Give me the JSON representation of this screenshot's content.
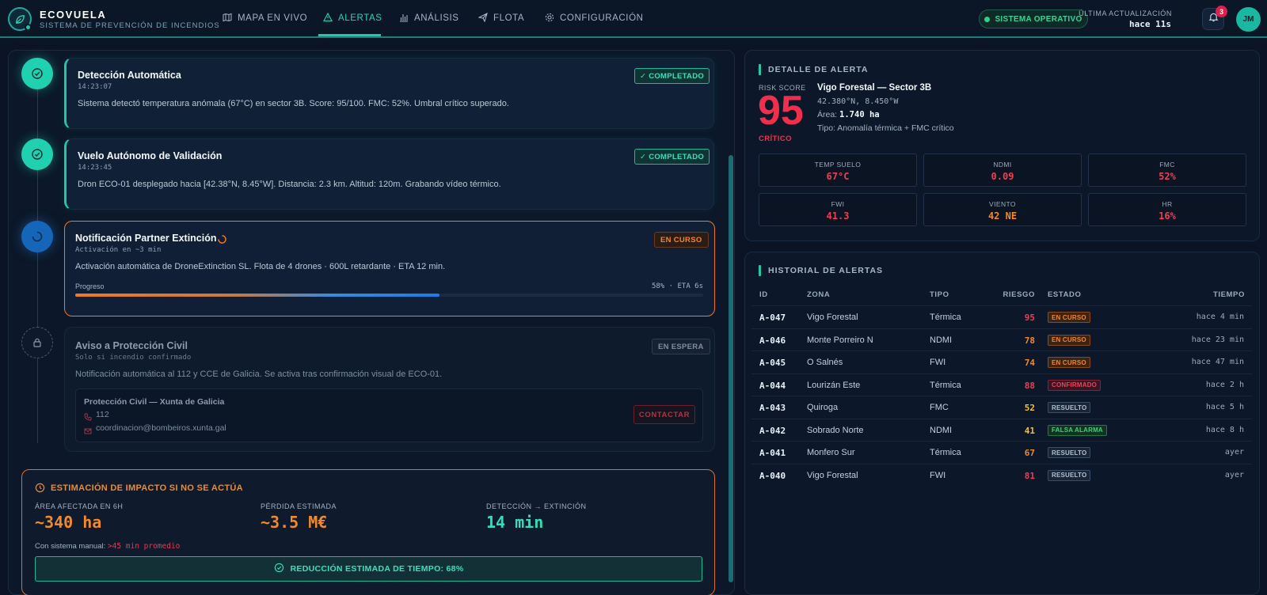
{
  "app": {
    "name": "ECOVUELA",
    "subtitle": "SISTEMA DE PREVENCIÓN DE INCENDIOS"
  },
  "nav": [
    {
      "label": "MAPA EN VIVO",
      "icon": "map-icon"
    },
    {
      "label": "ALERTAS",
      "icon": "alert-triangle-icon"
    },
    {
      "label": "ANÁLISIS",
      "icon": "bar-chart-icon"
    },
    {
      "label": "FLOTA",
      "icon": "plane-icon"
    },
    {
      "label": "CONFIGURACIÓN",
      "icon": "gear-icon"
    }
  ],
  "header": {
    "status": "SISTEMA OPERATIVO",
    "update_label": "ÚLTIMA ACTUALIZACIÓN",
    "update_value": "hace 11s",
    "notifications": "3",
    "user_initials": "JM"
  },
  "timeline": {
    "steps": [
      {
        "title": "Detección Automática",
        "time": "14:23:07",
        "description": "Sistema detectó temperatura anómala (67°C) en sector 3B. Score: 95/100. FMC: 52%. Umbral crítico superado.",
        "badge": "✓ COMPLETADO"
      },
      {
        "title": "Vuelo Autónomo de Validación",
        "time": "14:23:45",
        "description": "Dron ECO-01 desplegado hacia [42.38°N, 8.45°W]. Distancia: 2.3 km. Altitud: 120m. Grabando vídeo térmico.",
        "badge": "✓ COMPLETADO"
      },
      {
        "title": "Notificación Partner Extinción",
        "time": "Activación en ~3 min",
        "description": "Activación automática de DroneExtinction SL. Flota de 4 drones · 600L retardante · ETA 12 min.",
        "badge": "EN CURSO",
        "progress_label": "Progreso",
        "progress_text": "58% · ETA 6s",
        "progress": 0.58
      },
      {
        "title": "Aviso a Protección Civil",
        "time": "Solo si incendio confirmado",
        "description": "Notificación automática al 112 y CCE de Galicia. Se activa tras confirmación visual de ECO-01.",
        "badge": "EN ESPERA",
        "contact": {
          "name": "Protección Civil — Xunta de Galicia",
          "phone": "112",
          "email": "coordinacion@bombeiros.xunta.gal",
          "button": "CONTACTAR"
        }
      }
    ]
  },
  "impact": {
    "title": "ESTIMACIÓN DE IMPACTO SI NO SE ACTÚA",
    "metrics": [
      {
        "label": "ÁREA AFECTADA EN 6H",
        "value": "~340 ha",
        "color": "#f08a2c"
      },
      {
        "label": "PÉRDIDA ESTIMADA",
        "value": "~3.5 M€",
        "color": "#f08a2c"
      },
      {
        "label": "DETECCIÓN → EXTINCIÓN",
        "value": "14 min",
        "color": "#2fe0bd"
      }
    ],
    "manual_label": "Con sistema manual:",
    "manual_value": ">45 min promedio",
    "reduction": "REDUCCIÓN ESTIMADA DE TIEMPO: 68%"
  },
  "detail": {
    "header": "DETALLE DE ALERTA",
    "risk_label": "RISK SCORE",
    "risk_value": "95",
    "risk_level": "CRÍTICO",
    "location": "Vigo Forestal — Sector 3B",
    "coords": "42.380°N, 8.450°W",
    "area_label": "Área:",
    "area_value": "1.740 ha",
    "type": "Tipo: Anomalía térmica + FMC crítico",
    "metrics": [
      {
        "label": "TEMP SUELO",
        "value": "67°C",
        "color": "#ef3d54"
      },
      {
        "label": "NDMI",
        "value": "0.09",
        "color": "#ef3d54"
      },
      {
        "label": "FMC",
        "value": "52%",
        "color": "#ef3d54"
      },
      {
        "label": "FWI",
        "value": "41.3",
        "color": "#ef3d54"
      },
      {
        "label": "VIENTO",
        "value": "42 NE",
        "color": "#f08a2c"
      },
      {
        "label": "HR",
        "value": "16%",
        "color": "#ef3d54"
      }
    ]
  },
  "history": {
    "header": "HISTORIAL DE ALERTAS",
    "columns": [
      "ID",
      "ZONA",
      "TIPO",
      "RIESGO",
      "ESTADO",
      "TIEMPO"
    ],
    "rows": [
      {
        "id": "A-047",
        "zone": "Vigo Forestal",
        "type": "Térmica",
        "risk": "95",
        "risk_color": "#ef3d54",
        "status": "EN CURSO",
        "status_kind": "curso",
        "time": "hace 4 min"
      },
      {
        "id": "A-046",
        "zone": "Monte Porreiro N",
        "type": "NDMI",
        "risk": "78",
        "risk_color": "#f08a2c",
        "status": "EN CURSO",
        "status_kind": "curso",
        "time": "hace 23 min"
      },
      {
        "id": "A-045",
        "zone": "O Salnés",
        "type": "FWI",
        "risk": "74",
        "risk_color": "#f08a2c",
        "status": "EN CURSO",
        "status_kind": "curso",
        "time": "hace 47 min"
      },
      {
        "id": "A-044",
        "zone": "Lourizán Este",
        "type": "Térmica",
        "risk": "88",
        "risk_color": "#ef3d54",
        "status": "CONFIRMADO",
        "status_kind": "confirmado",
        "time": "hace 2 h"
      },
      {
        "id": "A-043",
        "zone": "Quiroga",
        "type": "FMC",
        "risk": "52",
        "risk_color": "#f2c230",
        "status": "RESUELTO",
        "status_kind": "resuelto",
        "time": "hace 5 h"
      },
      {
        "id": "A-042",
        "zone": "Sobrado Norte",
        "type": "NDMI",
        "risk": "41",
        "risk_color": "#f2c230",
        "status": "FALSA ALARMA",
        "status_kind": "falsa",
        "time": "hace 8 h"
      },
      {
        "id": "A-041",
        "zone": "Monfero Sur",
        "type": "Térmica",
        "risk": "67",
        "risk_color": "#f08a2c",
        "status": "RESUELTO",
        "status_kind": "resuelto",
        "time": "ayer"
      },
      {
        "id": "A-040",
        "zone": "Vigo Forestal",
        "type": "FWI",
        "risk": "81",
        "risk_color": "#ef3d54",
        "status": "RESUELTO",
        "status_kind": "resuelto",
        "time": "ayer"
      }
    ]
  }
}
